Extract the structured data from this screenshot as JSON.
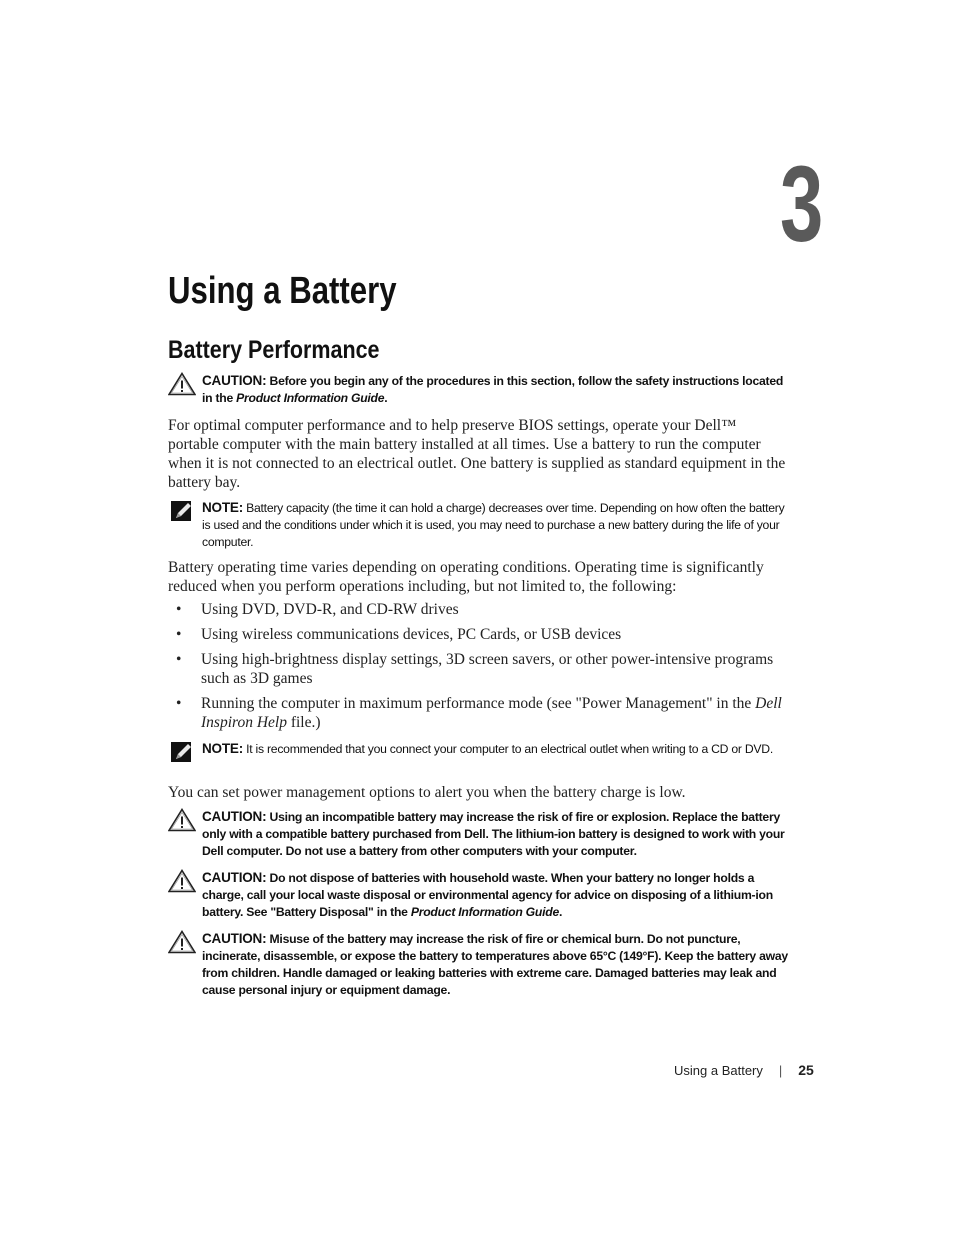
{
  "chapter": {
    "number": "3",
    "title": "Using a Battery"
  },
  "section": {
    "title": "Battery Performance"
  },
  "caution1": {
    "label": "CAUTION:",
    "text_before": " Before you begin any of the procedures in this section, follow the safety instructions located in the ",
    "italic": "Product Information Guide",
    "text_after": "."
  },
  "para1": "For optimal computer performance and to help preserve BIOS settings, operate your Dell™ portable computer with the main battery installed at all times. Use a battery to run the computer when it is not connected to an electrical outlet. One battery is supplied as standard equipment in the battery bay.",
  "note1": {
    "label": "NOTE:",
    "text": " Battery capacity (the time it can hold a charge) decreases over time. Depending on how often the battery is used and the conditions under which it is used, you may need to purchase a new battery during the life of your computer."
  },
  "para2": "Battery operating time varies depending on operating conditions. Operating time is significantly reduced when you perform operations including, but not limited to, the following:",
  "bullets": [
    {
      "text": "Using DVD, DVD-R, and CD-RW drives"
    },
    {
      "text": "Using wireless communications devices, PC Cards, or USB devices"
    },
    {
      "text": "Using high-brightness display settings, 3D screen savers, or other power-intensive programs such as 3D games"
    },
    {
      "text_before": "Running the computer in maximum performance mode (see \"Power Management\" in the ",
      "italic": "Dell Inspiron Help",
      "text_after": " file.)"
    }
  ],
  "bullet_glyph": "•",
  "note2": {
    "label": "NOTE:",
    "text": " It is recommended that you connect your computer to an electrical outlet when writing to a CD or DVD."
  },
  "para3": "You can set power management options to alert you when the battery charge is low.",
  "caution2": {
    "label": "CAUTION:",
    "text": " Using an incompatible battery may increase the risk of fire or explosion. Replace the battery only with a compatible battery purchased from Dell. The lithium-ion battery is designed to work with your Dell computer. Do not use a battery from other computers with your computer."
  },
  "caution3": {
    "label": "CAUTION:",
    "text_before": " Do not dispose of batteries with household waste. When your battery no longer holds a charge, call your local waste disposal or environmental agency for advice on disposing of a lithium-ion battery. See \"Battery Disposal\" in the ",
    "italic": "Product Information Guide",
    "text_after": "."
  },
  "caution4": {
    "label": "CAUTION:",
    "text": " Misuse of the battery may increase the risk of fire or chemical burn. Do not puncture, incinerate, disassemble, or expose the battery to temperatures above 65°C (149°F). Keep the battery away from children. Handle damaged or leaking batteries with extreme care. Damaged batteries may leak and cause personal injury or equipment damage."
  },
  "footer": {
    "section_name": "Using a Battery",
    "separator": "|",
    "page_number": "25"
  },
  "icons": {
    "caution": "warning-triangle-icon",
    "note": "pencil-note-icon"
  }
}
